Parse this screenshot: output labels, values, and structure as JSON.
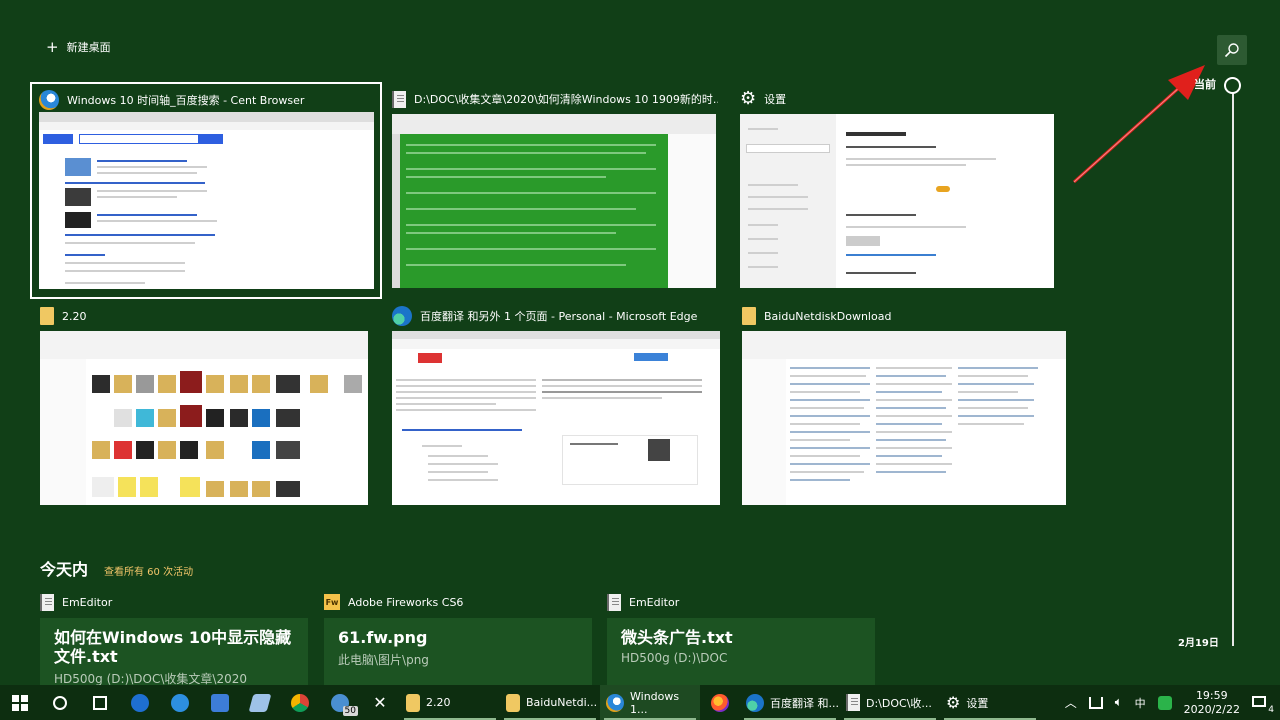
{
  "top": {
    "new_desktop_label": "新建桌面"
  },
  "timeline": {
    "now_label": "当前",
    "date_label": "2月19日"
  },
  "tasks": [
    {
      "title": "Windows 10 时间轴_百度搜索 - Cent Browser",
      "icon": "cent-browser-icon"
    },
    {
      "title": "D:\\DOC\\收集文章\\2020\\如何清除Windows 10 1909新的时...",
      "icon": "emeditor-icon"
    },
    {
      "title": "设置",
      "icon": "gear-icon"
    },
    {
      "title": "2.20",
      "icon": "folder-icon"
    },
    {
      "title": "百度翻译 和另外 1 个页面 - Personal - Microsoft Edge",
      "icon": "edge-icon"
    },
    {
      "title": "BaiduNetdiskDownload",
      "icon": "folder-icon"
    }
  ],
  "today": {
    "title": "今天内",
    "link": "查看所有 60 次活动"
  },
  "activities": [
    {
      "app": "EmEditor",
      "name": "如何在Windows 10中显示隐藏文件.txt",
      "path": "HD500g (D:)\\DOC\\收集文章\\2020",
      "icon": "emeditor-icon"
    },
    {
      "app": "Adobe Fireworks CS6",
      "name": "61.fw.png",
      "path": "此电脑\\图片\\png",
      "icon": "fireworks-icon"
    },
    {
      "app": "EmEditor",
      "name": "微头条广告.txt",
      "path": "HD500g (D:)\\DOC",
      "icon": "emeditor-icon"
    }
  ],
  "taskbar": {
    "badge": "50",
    "windows": [
      {
        "label": "2.20",
        "icon": "folder-icon"
      },
      {
        "label": "BaiduNetdi...",
        "icon": "folder-icon"
      },
      {
        "label": "Windows 1...",
        "icon": "cent-browser-icon"
      },
      {
        "label": "百度翻译 和...",
        "icon": "edge-icon"
      },
      {
        "label": "D:\\DOC\\收...",
        "icon": "emeditor-icon"
      },
      {
        "label": "设置",
        "icon": "gear-icon"
      }
    ],
    "ime": "中",
    "time": "19:59",
    "date": "2020/2/22",
    "notification_count": "4"
  },
  "colors": {
    "background": "#113f17",
    "card": "#1c5322",
    "accent_link": "#f3c66a",
    "arrow": "#e0201c"
  }
}
